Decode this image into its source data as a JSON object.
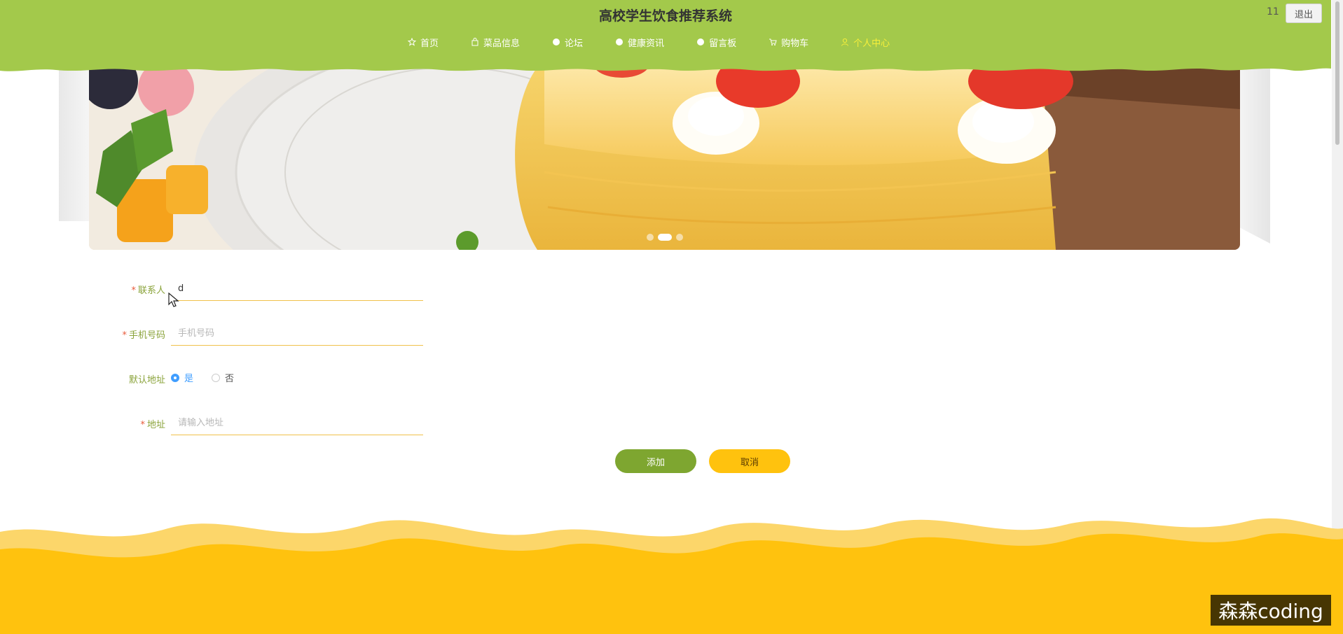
{
  "header": {
    "title": "高校学生饮食推荐系统",
    "user": "11",
    "logout_label": "退出",
    "colors": {
      "bar": "#a3c94b",
      "active_nav": "#f7ef3a"
    },
    "nav": [
      {
        "label": "首页",
        "icon": "star-icon"
      },
      {
        "label": "菜品信息",
        "icon": "bag-icon"
      },
      {
        "label": "论坛",
        "icon": "circle-icon"
      },
      {
        "label": "健康资讯",
        "icon": "circle-icon"
      },
      {
        "label": "留言板",
        "icon": "circle-icon"
      },
      {
        "label": "购物车",
        "icon": "cart-icon"
      },
      {
        "label": "个人中心",
        "icon": "user-icon",
        "active": true
      }
    ]
  },
  "banner": {
    "slide_count": 3,
    "active_slide": 2
  },
  "form": {
    "contact": {
      "label": "联系人",
      "value": "d",
      "required": true
    },
    "phone": {
      "label": "手机号码",
      "placeholder": "手机号码",
      "required": true
    },
    "default_address": {
      "label": "默认地址",
      "options": [
        "是",
        "否"
      ],
      "selected": "是"
    },
    "address": {
      "label": "地址",
      "placeholder": "请输入地址",
      "required": true
    }
  },
  "actions": {
    "add_label": "添加",
    "cancel_label": "取消"
  },
  "watermark": "森森coding"
}
